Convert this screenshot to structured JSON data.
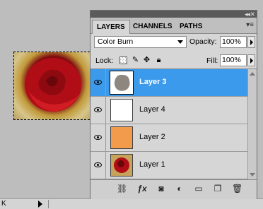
{
  "panel": {
    "tabs": [
      {
        "label": "LAYERS",
        "active": true
      },
      {
        "label": "CHANNELS",
        "active": false
      },
      {
        "label": "PATHS",
        "active": false
      }
    ],
    "blend_mode": "Color Burn",
    "opacity_label": "Opacity:",
    "opacity_value": "100%",
    "lock_label": "Lock:",
    "fill_label": "Fill:",
    "fill_value": "100%"
  },
  "layers": [
    {
      "name": "Layer 3",
      "selected": true,
      "thumb": "gray-blob"
    },
    {
      "name": "Layer 4",
      "selected": false,
      "thumb": "white"
    },
    {
      "name": "Layer 2",
      "selected": false,
      "thumb": "orange"
    },
    {
      "name": "Layer 1",
      "selected": false,
      "thumb": "rose"
    }
  ],
  "status": {
    "left_text": "K"
  },
  "colors": {
    "selection": "#3c9aec",
    "orange_fill": "#f29b4c"
  },
  "footer_icons": [
    "link-icon",
    "fx-icon",
    "mask-icon",
    "adjustment-icon",
    "group-icon",
    "new-layer-icon",
    "trash-icon"
  ]
}
